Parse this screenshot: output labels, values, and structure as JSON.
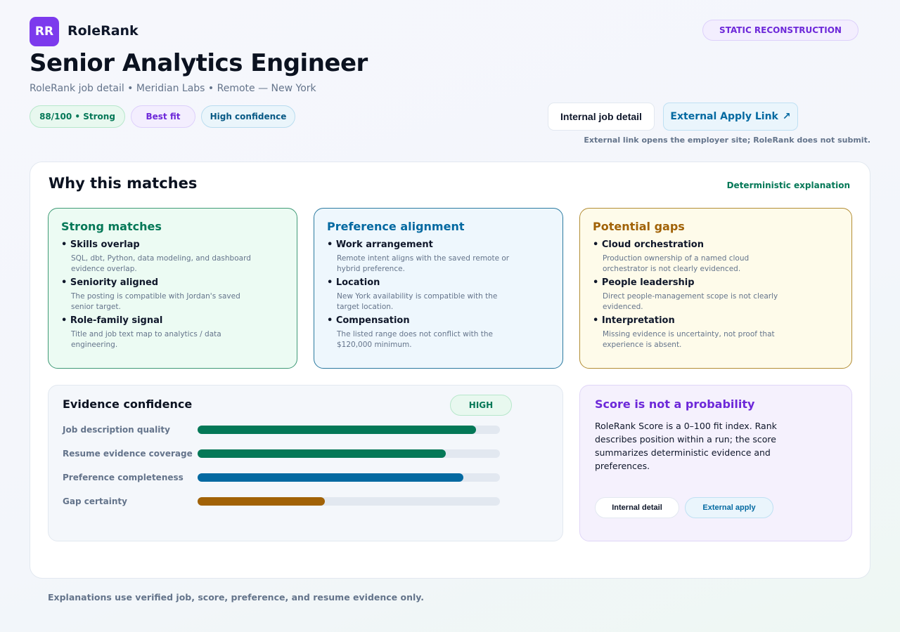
{
  "header": {
    "logo_text": "RR",
    "brand": "RoleRank",
    "static_badge": "STATIC RECONSTRUCTION",
    "title": "Senior Analytics Engineer",
    "subtitle": "RoleRank job detail • Meridian Labs • Remote — New York"
  },
  "chips": {
    "score": "88/100 • Strong",
    "fit": "Best fit",
    "confidence": "High confidence"
  },
  "actions": {
    "internal": "Internal job detail",
    "external": "External Apply Link",
    "external_icon": "↗",
    "note": "External link opens the employer site; RoleRank does not submit."
  },
  "why": {
    "title": "Why this matches",
    "label": "Deterministic explanation",
    "strong": {
      "title": "Strong matches",
      "items": [
        {
          "title": "• Skills overlap",
          "desc": "SQL, dbt, Python, data modeling, and dashboard evidence overlap."
        },
        {
          "title": "• Seniority aligned",
          "desc": "The posting is compatible with Jordan's saved senior target."
        },
        {
          "title": "• Role-family signal",
          "desc": "Title and job text map to analytics / data engineering."
        }
      ]
    },
    "preference": {
      "title": "Preference alignment",
      "items": [
        {
          "title": "• Work arrangement",
          "desc": "Remote intent aligns with the saved remote or hybrid preference."
        },
        {
          "title": "• Location",
          "desc": "New York availability is compatible with the target location."
        },
        {
          "title": "• Compensation",
          "desc": "The listed range does not conflict with the $120,000 minimum."
        }
      ]
    },
    "gaps": {
      "title": "Potential gaps",
      "items": [
        {
          "title": "• Cloud orchestration",
          "desc": "Production ownership of a named cloud orchestrator is not clearly evidenced."
        },
        {
          "title": "• People leadership",
          "desc": "Direct people-management scope is not clearly evidenced."
        },
        {
          "title": "• Interpretation",
          "desc": "Missing evidence is uncertainty, not proof that experience is absent."
        }
      ]
    }
  },
  "evidence": {
    "title": "Evidence confidence",
    "badge": "HIGH",
    "rows": [
      {
        "label": "Job description quality",
        "value": 0.92,
        "color": "#047857"
      },
      {
        "label": "Resume evidence coverage",
        "value": 0.82,
        "color": "#047857"
      },
      {
        "label": "Preference completeness",
        "value": 0.88,
        "color": "#0369a1"
      },
      {
        "label": "Gap certainty",
        "value": 0.42,
        "color": "#a16207"
      }
    ]
  },
  "score_note": {
    "title": "Score is not a probability",
    "text": "RoleRank Score is a 0–100 fit index. Rank describes position within a run; the score summarizes deterministic evidence and preferences.",
    "internal": "Internal detail",
    "external": "External apply"
  },
  "footer": "Explanations use verified job, score, preference, and resume evidence only."
}
